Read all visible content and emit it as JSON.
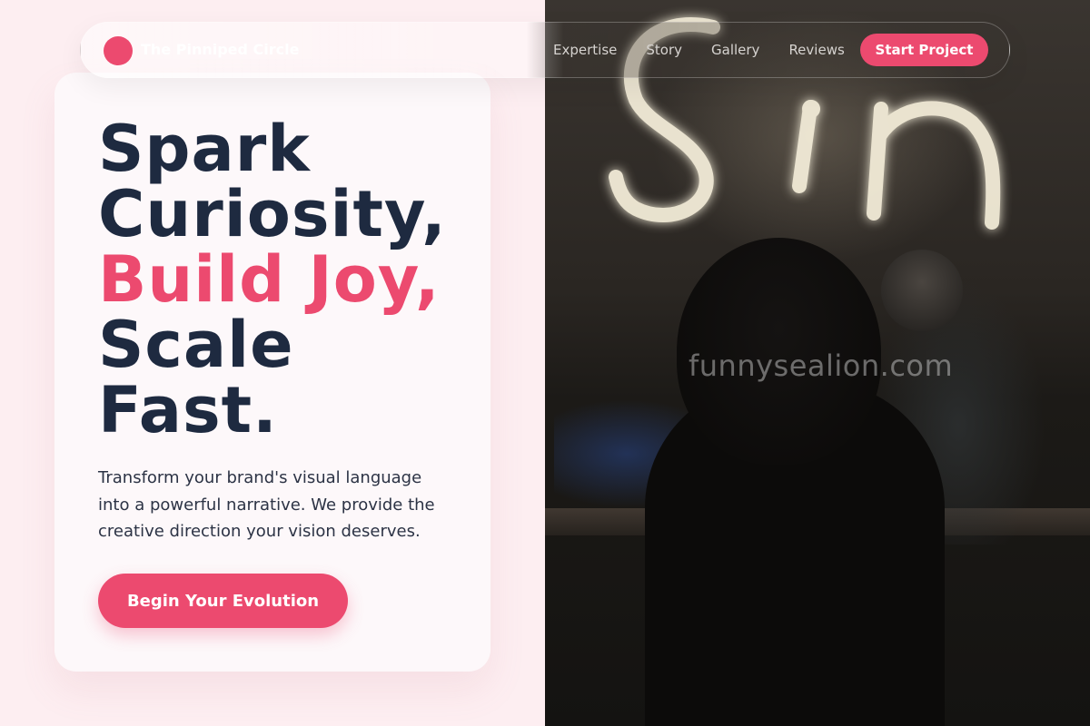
{
  "brand": {
    "name": "The Pinniped Circle",
    "accent_color": "#ec4a6f"
  },
  "nav": {
    "links": [
      "Expertise",
      "Story",
      "Gallery",
      "Reviews"
    ],
    "cta_label": "Start Project"
  },
  "hero": {
    "title_lines": [
      "Spark",
      "Curiosity,",
      "Build Joy,",
      "Scale",
      "Fast."
    ],
    "highlight_line": "Build Joy,",
    "description": "Transform your brand's visual language into a powerful narrative. We provide the creative direction your vision deserves.",
    "cta_label": "Begin Your Evolution"
  },
  "photo": {
    "neon_sign_text": "Sin",
    "watermark": "funnysealion.com"
  },
  "colors": {
    "page_background": "#fdeef1",
    "title_text": "#1e2a40",
    "card_background": "#fdf8fa"
  }
}
